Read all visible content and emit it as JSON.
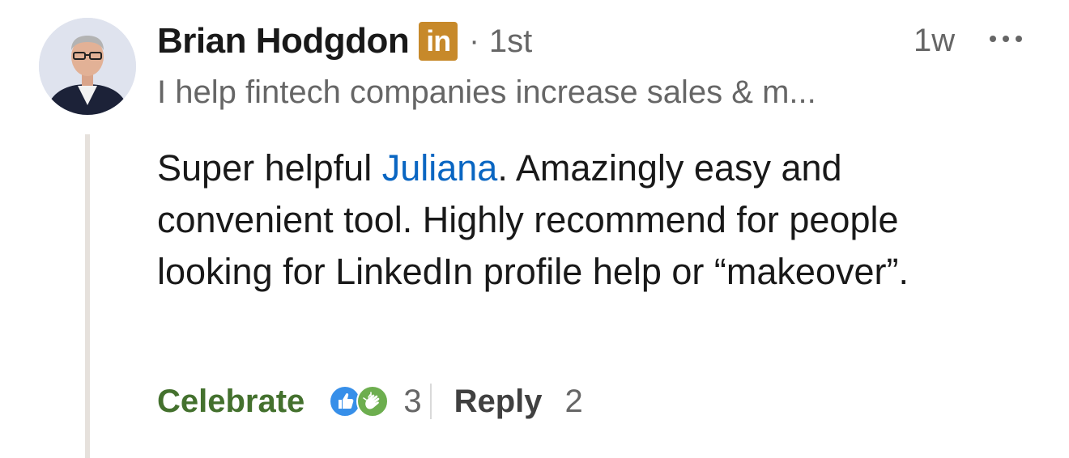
{
  "author": {
    "name": "Brian Hodgdon",
    "badge": "in",
    "separator": "·",
    "degree": "1st",
    "headline": "I help fintech companies increase sales & m...",
    "avatar_icon": "profile-photo"
  },
  "meta": {
    "time": "1w",
    "more_icon": "ellipsis-horizontal-icon"
  },
  "comment": {
    "before_mention": "Super helpful ",
    "mention": "Juliana",
    "after_mention": ". Amazingly easy and convenient tool. Highly recommend for people looking for LinkedIn profile help or “makeover”."
  },
  "actions": {
    "celebrate_label": "Celebrate",
    "reaction_icons": [
      "like-icon",
      "celebrate-icon"
    ],
    "reaction_count": "3",
    "reply_label": "Reply",
    "reply_count": "2"
  },
  "colors": {
    "celebrate_green": "#44712e",
    "mention_blue": "#0a66c2",
    "badge_gold": "#c7892a",
    "like_blue": "#378fe9",
    "celebrate_reaction_green": "#6dae4f"
  }
}
